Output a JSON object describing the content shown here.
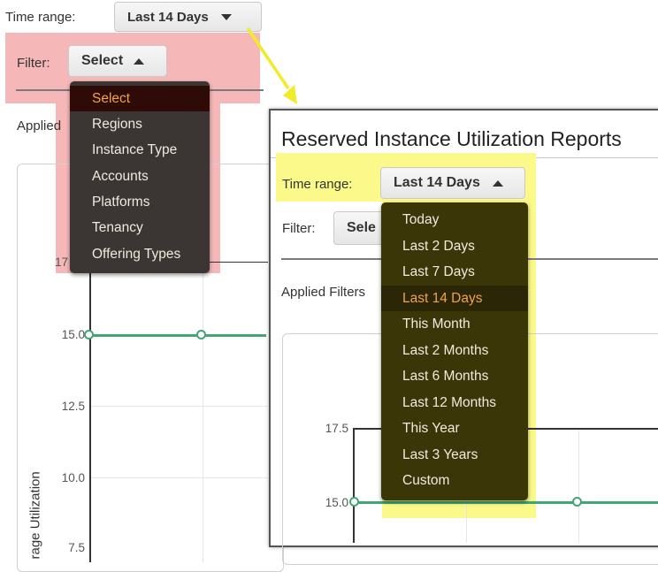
{
  "background_panel": {
    "time_range": {
      "label": "Time range:",
      "value": "Last 14 Days"
    },
    "filter": {
      "label": "Filter:",
      "value": "Select",
      "menu": {
        "items": [
          "Select",
          "Regions",
          "Instance Type",
          "Accounts",
          "Platforms",
          "Tenancy",
          "Offering Types"
        ],
        "selected": "Select"
      }
    },
    "applied_filters_label": "Applied",
    "chart": {
      "ylabel": "rage Utilization",
      "yticks": [
        "17",
        "15.0",
        "12.5",
        "10.0",
        "7.5"
      ]
    }
  },
  "inset_panel": {
    "title": "Reserved Instance Utilization Reports",
    "time_range": {
      "label": "Time range:",
      "value": "Last 14 Days",
      "menu": {
        "items": [
          "Today",
          "Last 2 Days",
          "Last 7 Days",
          "Last 14 Days",
          "This Month",
          "Last 2 Months",
          "Last 6 Months",
          "Last 12 Months",
          "This Year",
          "Last 3 Years",
          "Custom"
        ],
        "selected": "Last 14 Days"
      }
    },
    "filter": {
      "label": "Filter:",
      "value": "Sele"
    },
    "applied_filters_label": "Applied Filters",
    "chart": {
      "yticks": [
        "17.5",
        "15.0"
      ]
    }
  },
  "colors": {
    "highlight_pink": "#f5b7b8",
    "highlight_yellow": "#fbf98a",
    "arrow": "#f0ec2a",
    "filter_menu_bg": "#3b3533",
    "filter_menu_selected_bg": "#2e0b06",
    "timerange_menu_bg": "#3b3608",
    "timerange_menu_selected_bg": "#2a2606",
    "menu_text": "#f2eadf",
    "menu_selected_text": "#f1a34a",
    "series_line": "#41a574"
  }
}
